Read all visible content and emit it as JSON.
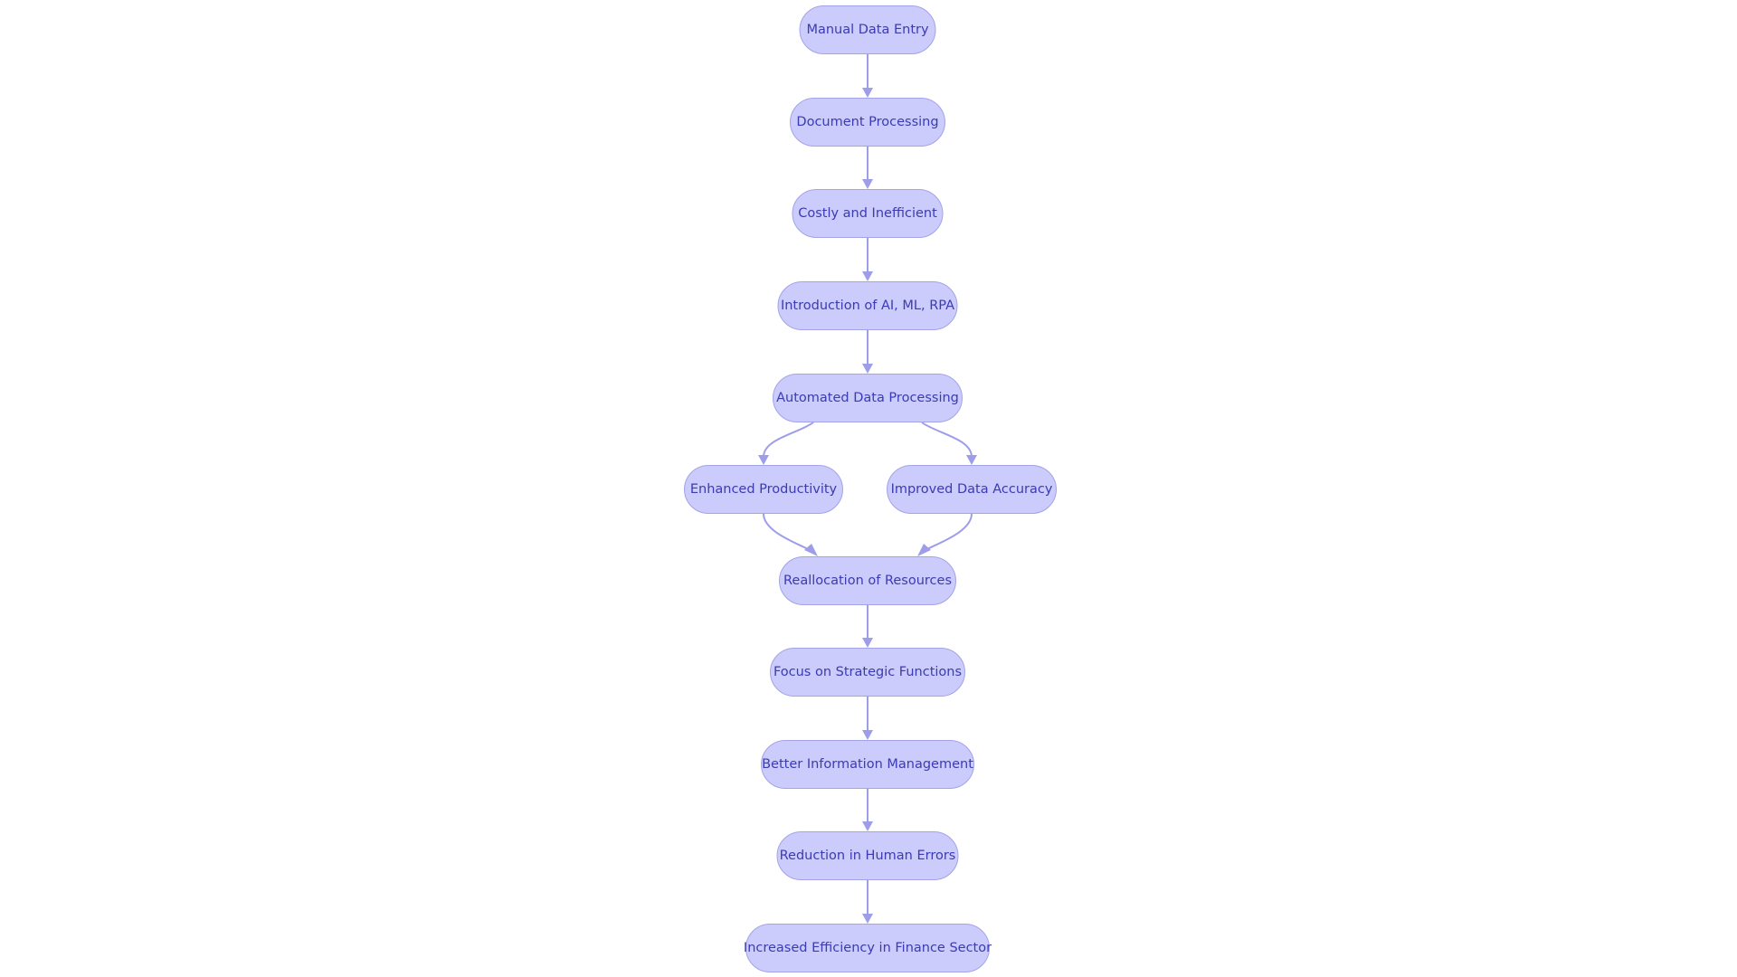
{
  "colors": {
    "node_fill": "#cbcbfc",
    "node_stroke": "#a3a3e8",
    "text": "#3b3bb3",
    "edge": "#9d9dea"
  },
  "nodes": [
    {
      "id": "manual",
      "label": "Manual Data Entry"
    },
    {
      "id": "document",
      "label": "Document Processing"
    },
    {
      "id": "costly",
      "label": "Costly and Inefficient"
    },
    {
      "id": "intro",
      "label": "Introduction of AI, ML, RPA"
    },
    {
      "id": "automated",
      "label": "Automated Data Processing"
    },
    {
      "id": "enhanced",
      "label": "Enhanced Productivity"
    },
    {
      "id": "improved",
      "label": "Improved Data Accuracy"
    },
    {
      "id": "realloc",
      "label": "Reallocation of Resources"
    },
    {
      "id": "focus",
      "label": "Focus on Strategic Functions"
    },
    {
      "id": "better",
      "label": "Better Information Management"
    },
    {
      "id": "reduction",
      "label": "Reduction in Human Errors"
    },
    {
      "id": "increased",
      "label": "Increased Efficiency in Finance Sector"
    }
  ],
  "edges": [
    [
      "manual",
      "document"
    ],
    [
      "document",
      "costly"
    ],
    [
      "costly",
      "intro"
    ],
    [
      "intro",
      "automated"
    ],
    [
      "automated",
      "enhanced"
    ],
    [
      "automated",
      "improved"
    ],
    [
      "enhanced",
      "realloc"
    ],
    [
      "improved",
      "realloc"
    ],
    [
      "realloc",
      "focus"
    ],
    [
      "focus",
      "better"
    ],
    [
      "better",
      "reduction"
    ],
    [
      "reduction",
      "increased"
    ]
  ]
}
